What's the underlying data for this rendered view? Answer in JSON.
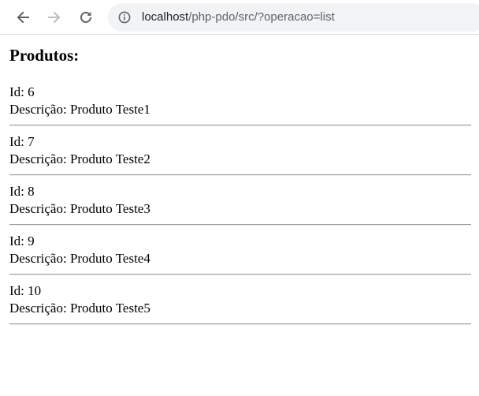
{
  "browser": {
    "url_host": "localhost",
    "url_path": "/php-pdo/src/?operacao=list",
    "icons": {
      "back": "back-arrow-icon",
      "forward": "forward-arrow-icon",
      "reload": "reload-icon",
      "info": "info-icon"
    }
  },
  "page": {
    "title": "Produtos:",
    "id_label": "Id: ",
    "description_label": "Descrição: ",
    "products": [
      {
        "id": "6",
        "description": "Produto Teste1"
      },
      {
        "id": "7",
        "description": "Produto Teste2"
      },
      {
        "id": "8",
        "description": "Produto Teste3"
      },
      {
        "id": "9",
        "description": "Produto Teste4"
      },
      {
        "id": "10",
        "description": "Produto Teste5"
      }
    ]
  }
}
